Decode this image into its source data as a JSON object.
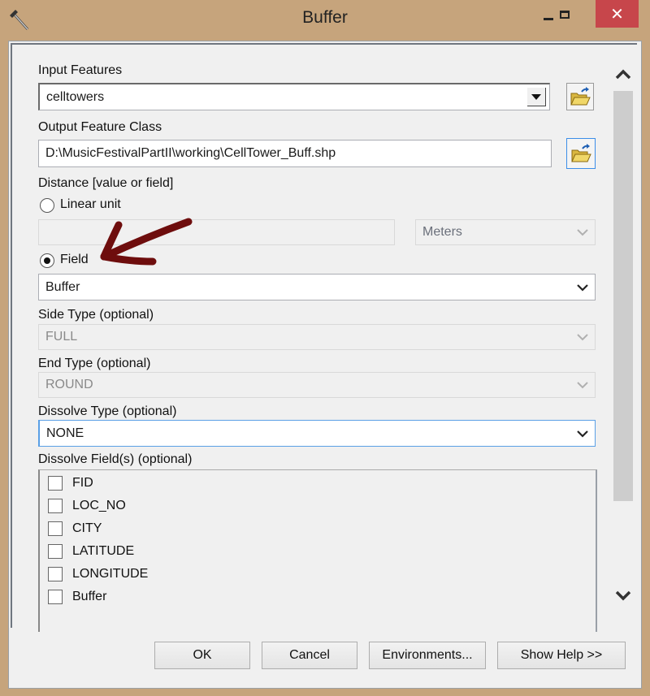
{
  "window": {
    "title": "Buffer",
    "app_icon": "hammer-icon",
    "controls": {
      "minimize": "minimize-icon",
      "maximize": "maximize-icon",
      "close": "✕"
    }
  },
  "form": {
    "input_features": {
      "label": "Input Features",
      "value": "celltowers",
      "browse_icon": "open-folder-icon"
    },
    "output_feature_class": {
      "label": "Output Feature Class",
      "value": "D:\\MusicFestivalPartII\\working\\CellTower_Buff.shp",
      "browse_icon": "open-folder-icon"
    },
    "distance": {
      "label": "Distance [value or field]",
      "linear_unit": {
        "label": "Linear unit",
        "selected": false,
        "value": "",
        "unit": "Meters"
      },
      "field": {
        "label": "Field",
        "selected": true,
        "value": "Buffer"
      }
    },
    "side_type": {
      "label": "Side Type (optional)",
      "value": "FULL",
      "enabled": false
    },
    "end_type": {
      "label": "End Type (optional)",
      "value": "ROUND",
      "enabled": false
    },
    "dissolve_type": {
      "label": "Dissolve Type (optional)",
      "value": "NONE",
      "enabled": true
    },
    "dissolve_fields": {
      "label": "Dissolve Field(s) (optional)",
      "items": [
        {
          "label": "FID",
          "checked": false
        },
        {
          "label": "LOC_NO",
          "checked": false
        },
        {
          "label": "CITY",
          "checked": false
        },
        {
          "label": "LATITUDE",
          "checked": false
        },
        {
          "label": "LONGITUDE",
          "checked": false
        },
        {
          "label": "Buffer",
          "checked": false
        }
      ]
    }
  },
  "buttons": {
    "ok": "OK",
    "cancel": "Cancel",
    "environments": "Environments...",
    "show_help": "Show Help >>"
  },
  "annotation": {
    "type": "hand-drawn arrow",
    "points_to": "Field radio option",
    "color": "#6e0d0d"
  },
  "colors": {
    "frame": "#c6a47c",
    "close": "#c7464b",
    "focus": "#5aa0e6"
  }
}
